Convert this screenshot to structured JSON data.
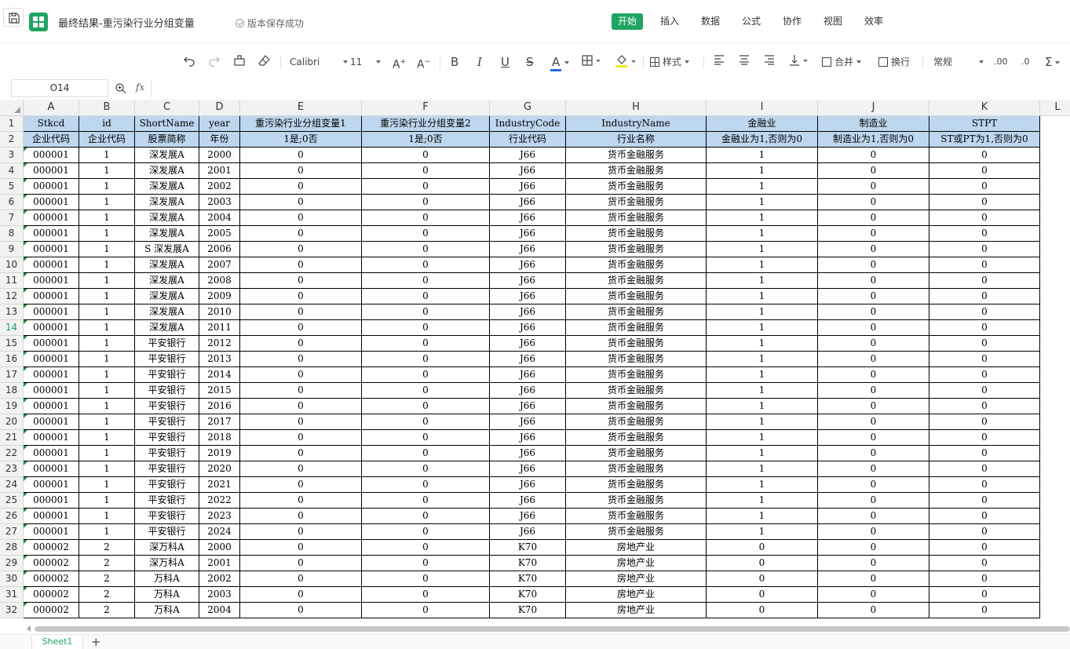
{
  "app": {
    "document_title": "最终结果-重污染行业分组变量",
    "save_status": "版本保存成功",
    "accent_color": "#1fa462"
  },
  "menus": [
    "开始",
    "插入",
    "数据",
    "公式",
    "协作",
    "视图",
    "效率"
  ],
  "active_menu": "开始",
  "toolbar": {
    "font_name": "Calibri",
    "font_size": "11",
    "style_label": "样式",
    "merge_label": "合并",
    "wrap_label": "换行",
    "number_format": "常规",
    "icons": [
      "undo-icon",
      "redo-icon",
      "format-painter-icon",
      "eraser-icon",
      "font-size-increase-icon",
      "font-size-decrease-icon",
      "bold-icon",
      "italic-icon",
      "underline-icon",
      "strikethrough-icon",
      "font-color-icon",
      "border-icon",
      "fill-color-icon",
      "style-icon",
      "align-left-icon",
      "align-center-icon",
      "align-right-icon",
      "vertical-align-icon",
      "merge-icon",
      "wrap-icon",
      "decimal-increase-icon",
      "decimal-decrease-icon",
      "sum-icon"
    ]
  },
  "formula_bar": {
    "cell_ref": "O14",
    "fx": "fx",
    "value": ""
  },
  "sheet": {
    "columns": [
      "A",
      "B",
      "C",
      "D",
      "E",
      "F",
      "G",
      "H",
      "I",
      "J",
      "K",
      "L"
    ],
    "selected_row": 14,
    "header_rows": [
      [
        "Stkcd",
        "id",
        "ShortName",
        "year",
        "重污染行业分组变量1",
        "重污染行业分组变量2",
        "IndustryCode",
        "IndustryName",
        "金融业",
        "制造业",
        "STPT"
      ],
      [
        "企业代码",
        "企业代码",
        "股票简称",
        "年份",
        "1是;0否",
        "1是;0否",
        "行业代码",
        "行业名称",
        "金融业为1,否则为0",
        "制造业为1,否则为0",
        "ST或PT为1,否则为0"
      ]
    ],
    "data_rows": [
      [
        "000001",
        "1",
        "深发展A",
        "2000",
        "0",
        "0",
        "J66",
        "货币金融服务",
        "1",
        "0",
        "0"
      ],
      [
        "000001",
        "1",
        "深发展A",
        "2001",
        "0",
        "0",
        "J66",
        "货币金融服务",
        "1",
        "0",
        "0"
      ],
      [
        "000001",
        "1",
        "深发展A",
        "2002",
        "0",
        "0",
        "J66",
        "货币金融服务",
        "1",
        "0",
        "0"
      ],
      [
        "000001",
        "1",
        "深发展A",
        "2003",
        "0",
        "0",
        "J66",
        "货币金融服务",
        "1",
        "0",
        "0"
      ],
      [
        "000001",
        "1",
        "深发展A",
        "2004",
        "0",
        "0",
        "J66",
        "货币金融服务",
        "1",
        "0",
        "0"
      ],
      [
        "000001",
        "1",
        "深发展A",
        "2005",
        "0",
        "0",
        "J66",
        "货币金融服务",
        "1",
        "0",
        "0"
      ],
      [
        "000001",
        "1",
        "S 深发展A",
        "2006",
        "0",
        "0",
        "J66",
        "货币金融服务",
        "1",
        "0",
        "0"
      ],
      [
        "000001",
        "1",
        "深发展A",
        "2007",
        "0",
        "0",
        "J66",
        "货币金融服务",
        "1",
        "0",
        "0"
      ],
      [
        "000001",
        "1",
        "深发展A",
        "2008",
        "0",
        "0",
        "J66",
        "货币金融服务",
        "1",
        "0",
        "0"
      ],
      [
        "000001",
        "1",
        "深发展A",
        "2009",
        "0",
        "0",
        "J66",
        "货币金融服务",
        "1",
        "0",
        "0"
      ],
      [
        "000001",
        "1",
        "深发展A",
        "2010",
        "0",
        "0",
        "J66",
        "货币金融服务",
        "1",
        "0",
        "0"
      ],
      [
        "000001",
        "1",
        "深发展A",
        "2011",
        "0",
        "0",
        "J66",
        "货币金融服务",
        "1",
        "0",
        "0"
      ],
      [
        "000001",
        "1",
        "平安银行",
        "2012",
        "0",
        "0",
        "J66",
        "货币金融服务",
        "1",
        "0",
        "0"
      ],
      [
        "000001",
        "1",
        "平安银行",
        "2013",
        "0",
        "0",
        "J66",
        "货币金融服务",
        "1",
        "0",
        "0"
      ],
      [
        "000001",
        "1",
        "平安银行",
        "2014",
        "0",
        "0",
        "J66",
        "货币金融服务",
        "1",
        "0",
        "0"
      ],
      [
        "000001",
        "1",
        "平安银行",
        "2015",
        "0",
        "0",
        "J66",
        "货币金融服务",
        "1",
        "0",
        "0"
      ],
      [
        "000001",
        "1",
        "平安银行",
        "2016",
        "0",
        "0",
        "J66",
        "货币金融服务",
        "1",
        "0",
        "0"
      ],
      [
        "000001",
        "1",
        "平安银行",
        "2017",
        "0",
        "0",
        "J66",
        "货币金融服务",
        "1",
        "0",
        "0"
      ],
      [
        "000001",
        "1",
        "平安银行",
        "2018",
        "0",
        "0",
        "J66",
        "货币金融服务",
        "1",
        "0",
        "0"
      ],
      [
        "000001",
        "1",
        "平安银行",
        "2019",
        "0",
        "0",
        "J66",
        "货币金融服务",
        "1",
        "0",
        "0"
      ],
      [
        "000001",
        "1",
        "平安银行",
        "2020",
        "0",
        "0",
        "J66",
        "货币金融服务",
        "1",
        "0",
        "0"
      ],
      [
        "000001",
        "1",
        "平安银行",
        "2021",
        "0",
        "0",
        "J66",
        "货币金融服务",
        "1",
        "0",
        "0"
      ],
      [
        "000001",
        "1",
        "平安银行",
        "2022",
        "0",
        "0",
        "J66",
        "货币金融服务",
        "1",
        "0",
        "0"
      ],
      [
        "000001",
        "1",
        "平安银行",
        "2023",
        "0",
        "0",
        "J66",
        "货币金融服务",
        "1",
        "0",
        "0"
      ],
      [
        "000001",
        "1",
        "平安银行",
        "2024",
        "0",
        "0",
        "J66",
        "货币金融服务",
        "1",
        "0",
        "0"
      ],
      [
        "000002",
        "2",
        "深万科A",
        "2000",
        "0",
        "0",
        "K70",
        "房地产业",
        "0",
        "0",
        "0"
      ],
      [
        "000002",
        "2",
        "深万科A",
        "2001",
        "0",
        "0",
        "K70",
        "房地产业",
        "0",
        "0",
        "0"
      ],
      [
        "000002",
        "2",
        "万科A",
        "2002",
        "0",
        "0",
        "K70",
        "房地产业",
        "0",
        "0",
        "0"
      ],
      [
        "000002",
        "2",
        "万科A",
        "2003",
        "0",
        "0",
        "K70",
        "房地产业",
        "0",
        "0",
        "0"
      ],
      [
        "000002",
        "2",
        "万科A",
        "2004",
        "0",
        "0",
        "K70",
        "房地产业",
        "0",
        "0",
        "0"
      ]
    ]
  },
  "sheets": [
    "Sheet1"
  ],
  "add_sheet": "+"
}
